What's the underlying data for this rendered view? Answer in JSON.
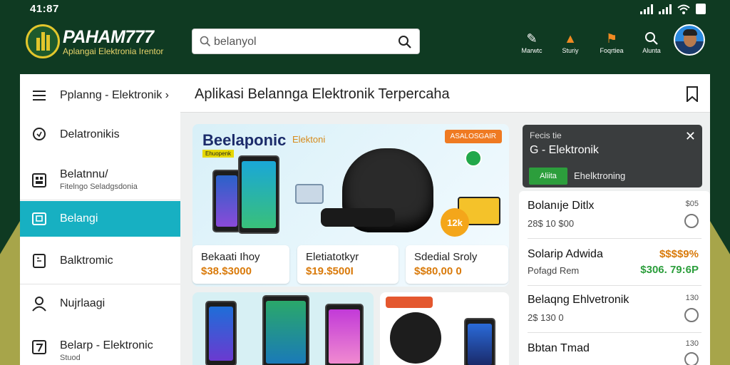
{
  "status_bar": {
    "time": "41:87"
  },
  "header": {
    "brand": "PAHAM777",
    "brand_sub": "Aplangai Elektronia Irentor",
    "search": {
      "value": "belanyol"
    },
    "actions": [
      {
        "icon": "tools-icon",
        "label": "Marwtc"
      },
      {
        "icon": "warning-icon",
        "label": "Sturiy"
      },
      {
        "icon": "megaphone-icon",
        "label": "Foqrtiea"
      },
      {
        "icon": "search-icon",
        "label": "Alunta"
      }
    ]
  },
  "sidebar": {
    "items": [
      {
        "label": "Pplanng - Elektronik ›",
        "icon": "menu-icon"
      },
      {
        "label": "Delatronikis",
        "icon": "chat-icon"
      },
      {
        "label": "Belatnnu/",
        "sub": "Fitelngo Seladgsdonia",
        "icon": "grid-icon"
      },
      {
        "label": "Belangi",
        "icon": "box-icon",
        "active": true
      },
      {
        "label": "Balktromic",
        "icon": "device-icon"
      },
      {
        "label": "Nujrlaagi",
        "icon": "user-icon"
      },
      {
        "label": "Belarp - Elektronic",
        "sub": "Stuod",
        "icon": "number-icon"
      }
    ]
  },
  "main": {
    "title": "Aplikasi Belannga Elektronik Terpercaha",
    "banner": {
      "title": "Beelaponic",
      "tag": "Ehuopenk",
      "sub": "Elektoni",
      "badge": "ASALOSGAIR",
      "round": "12k"
    },
    "products": [
      {
        "name": "Bekaati Ihoy",
        "price": "$38.$3000"
      },
      {
        "name": "Eletiatotkyr",
        "price": "$19.$500I"
      },
      {
        "name": "Sdedial Sroly",
        "price": "$$80,00 0"
      }
    ]
  },
  "toast": {
    "title": "Fecis tie",
    "message": "G - Elektronik",
    "button": "Aliita",
    "note": "Ehelktroning"
  },
  "right_list": [
    {
      "name": "Bolanıje Ditlx",
      "sub": "28$ 10 $00",
      "price_small": "$05"
    },
    {
      "name": "Solarip Adwida",
      "sub": "Pofagd Rem",
      "price_top": "$$$$9%",
      "price_bottom": "$306. 79:6P"
    },
    {
      "name": "Belaqng Ehlvetronik",
      "sub": "2$ 130 0",
      "price_small": "130"
    },
    {
      "name": "Bbtan Tmad",
      "sub": "",
      "price_small": "130"
    }
  ],
  "colors": {
    "header_bg": "#0f3a22",
    "active": "#17b0c2",
    "price": "#d97a0a",
    "price_green": "#2c9e3c"
  }
}
